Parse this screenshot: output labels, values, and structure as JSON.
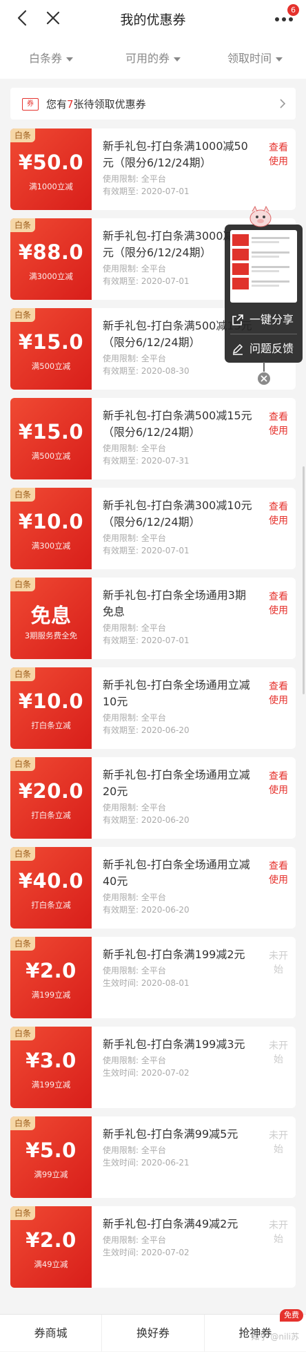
{
  "nav": {
    "title": "我的优惠券",
    "badge": "6",
    "back_icon": "back-arrow-icon",
    "close_icon": "close-icon",
    "more_icon": "more-icon"
  },
  "filters": [
    {
      "label": "白条券"
    },
    {
      "label": "可用的券"
    },
    {
      "label": "领取时间"
    }
  ],
  "notice": {
    "icon_label": "券",
    "prefix": "您有",
    "count": "7",
    "suffix": "张待领取优惠券"
  },
  "coupons": [
    {
      "tag": "白条",
      "amount": "¥50.0",
      "cond": "满1000立减",
      "title": "新手礼包-打白条满1000减50元（限分6/12/24期）",
      "limit": "使用限制: 全平台",
      "date": "有效期至: 2020-07-01",
      "action": "查看使用",
      "active": true
    },
    {
      "tag": "白条",
      "amount": "¥88.0",
      "cond": "满3000立减",
      "title": "新手礼包-打白条满3000减88元（限分6/12/24期）",
      "limit": "使用限制: 全平台",
      "date": "有效期至: 2020-07-01",
      "action": "",
      "active": true
    },
    {
      "tag": "白条",
      "amount": "¥15.0",
      "cond": "满500立减",
      "title": "新手礼包-打白条满500减15元（限分6/12/24期）",
      "limit": "使用限制: 全平台",
      "date": "有效期至: 2020-08-30",
      "action": "",
      "active": true
    },
    {
      "tag": "",
      "amount": "¥15.0",
      "cond": "满500立减",
      "title": "新手礼包-打白条满500减15元（限分6/12/24期）",
      "limit": "使用限制: 全平台",
      "date": "有效期至: 2020-07-31",
      "action": "查看使用",
      "active": true
    },
    {
      "tag": "白条",
      "amount": "¥10.0",
      "cond": "满300立减",
      "title": "新手礼包-打白条满300减10元（限分6/12/24期）",
      "limit": "使用限制: 全平台",
      "date": "有效期至: 2020-07-01",
      "action": "查看使用",
      "active": true
    },
    {
      "tag": "白条",
      "amount": "免息",
      "cond": "3期服务费全免",
      "title": "新手礼包-打白条全场通用3期免息",
      "limit": "使用限制: 全平台",
      "date": "有效期至: 2020-07-01",
      "action": "查看使用",
      "active": true
    },
    {
      "tag": "白条",
      "amount": "¥10.0",
      "cond": "打白条立减",
      "title": "新手礼包-打白条全场通用立减10元",
      "limit": "使用限制: 全平台",
      "date": "有效期至: 2020-06-20",
      "action": "查看使用",
      "active": true
    },
    {
      "tag": "白条",
      "amount": "¥20.0",
      "cond": "打白条立减",
      "title": "新手礼包-打白条全场通用立减20元",
      "limit": "使用限制: 全平台",
      "date": "有效期至: 2020-06-20",
      "action": "查看使用",
      "active": true
    },
    {
      "tag": "白条",
      "amount": "¥40.0",
      "cond": "打白条立减",
      "title": "新手礼包-打白条全场通用立减40元",
      "limit": "使用限制: 全平台",
      "date": "有效期至: 2020-06-20",
      "action": "查看使用",
      "active": true
    },
    {
      "tag": "白条",
      "amount": "¥2.0",
      "cond": "满199立减",
      "title": "新手礼包-打白条满199减2元",
      "limit": "使用限制: 全平台",
      "date": "生效时间: 2020-08-01",
      "action": "未开始",
      "active": false
    },
    {
      "tag": "白条",
      "amount": "¥3.0",
      "cond": "满199立减",
      "title": "新手礼包-打白条满199减3元",
      "limit": "使用限制: 全平台",
      "date": "生效时间: 2020-07-02",
      "action": "未开始",
      "active": false
    },
    {
      "tag": "白条",
      "amount": "¥5.0",
      "cond": "满99立减",
      "title": "新手礼包-打白条满99减5元",
      "limit": "使用限制: 全平台",
      "date": "生效时间: 2020-06-21",
      "action": "未开始",
      "active": false
    },
    {
      "tag": "白条",
      "amount": "¥2.0",
      "cond": "满49立减",
      "title": "新手礼包-打白条满49减2元",
      "limit": "使用限制: 全平台",
      "date": "生效时间: 2020-07-02",
      "action": "未开始",
      "active": false
    }
  ],
  "popup": {
    "share_label": "一键分享",
    "feedback_label": "问题反馈",
    "share_icon": "share-icon",
    "feedback_icon": "edit-icon"
  },
  "tabs": [
    {
      "label": "券商城"
    },
    {
      "label": "换好券"
    },
    {
      "label": "抢神券",
      "badge": "免费"
    }
  ],
  "watermark": "知乎 @nili苏",
  "colors": {
    "brand_red": "#e5322d",
    "tag_gold": "#f6d7a7"
  }
}
